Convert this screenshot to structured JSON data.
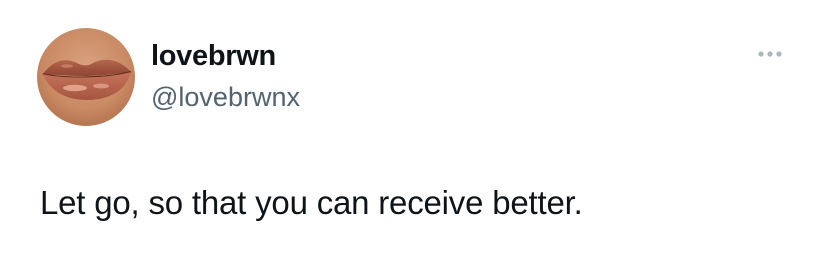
{
  "author": {
    "display_name": "lovebrwn",
    "handle": "@lovebrwnx",
    "avatar_icon": "lips-photo-avatar"
  },
  "tweet": {
    "text": "Let go, so that you can receive better."
  },
  "menu": {
    "icon": "more-horizontal-icon"
  },
  "colors": {
    "text_primary": "#0f1419",
    "text_secondary": "#536471",
    "more_icon": "#aab8c2",
    "background": "#ffffff"
  }
}
